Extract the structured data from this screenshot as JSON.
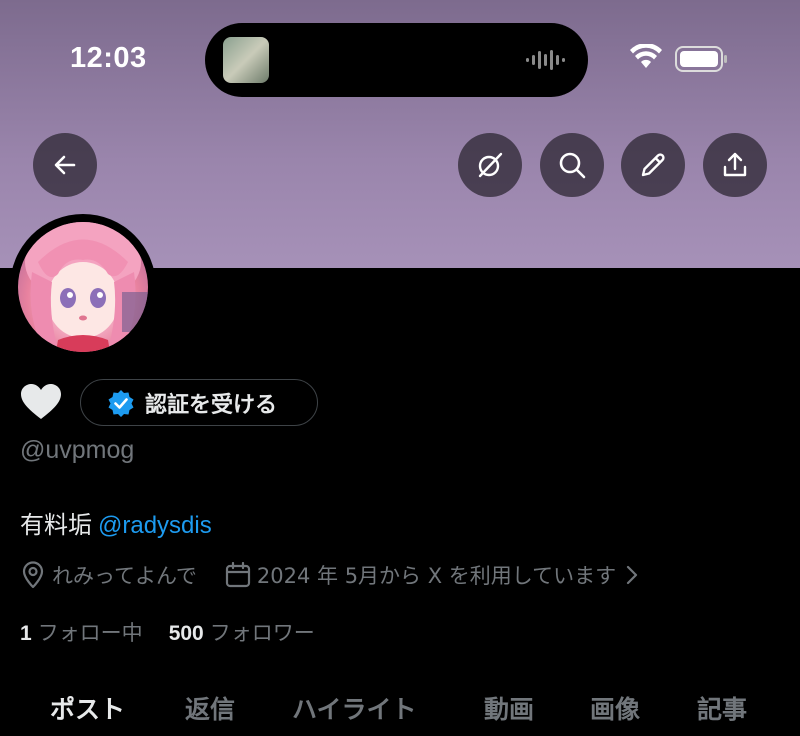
{
  "status_bar": {
    "time": "12:03",
    "icons": [
      "wifi-icon",
      "battery-icon"
    ]
  },
  "header": {
    "buttons": [
      {
        "icon": "back-arrow-icon"
      },
      {
        "icon": "grok-icon"
      },
      {
        "icon": "search-icon"
      },
      {
        "icon": "edit-pencil-icon"
      },
      {
        "icon": "share-icon"
      }
    ]
  },
  "profile": {
    "verify_label": "認証を受ける",
    "handle": "@uvpmog",
    "bio_text": "有料垢",
    "bio_mention": "@radysdis",
    "location": "れみってよんで",
    "joined": "2024 年 5月から X を利用しています",
    "following_count": "1",
    "following_label": "フォロー中",
    "followers_count": "500",
    "followers_label": "フォロワー"
  },
  "tabs": [
    {
      "label": "ポスト",
      "active": true
    },
    {
      "label": "返信",
      "active": false
    },
    {
      "label": "ハイライト",
      "active": false
    },
    {
      "label": "動画",
      "active": false
    },
    {
      "label": "画像",
      "active": false
    },
    {
      "label": "記事",
      "active": false
    }
  ],
  "colors": {
    "accent_blue": "#1d9bf0",
    "muted_text": "#71767b",
    "banner": "#9a85ac"
  }
}
